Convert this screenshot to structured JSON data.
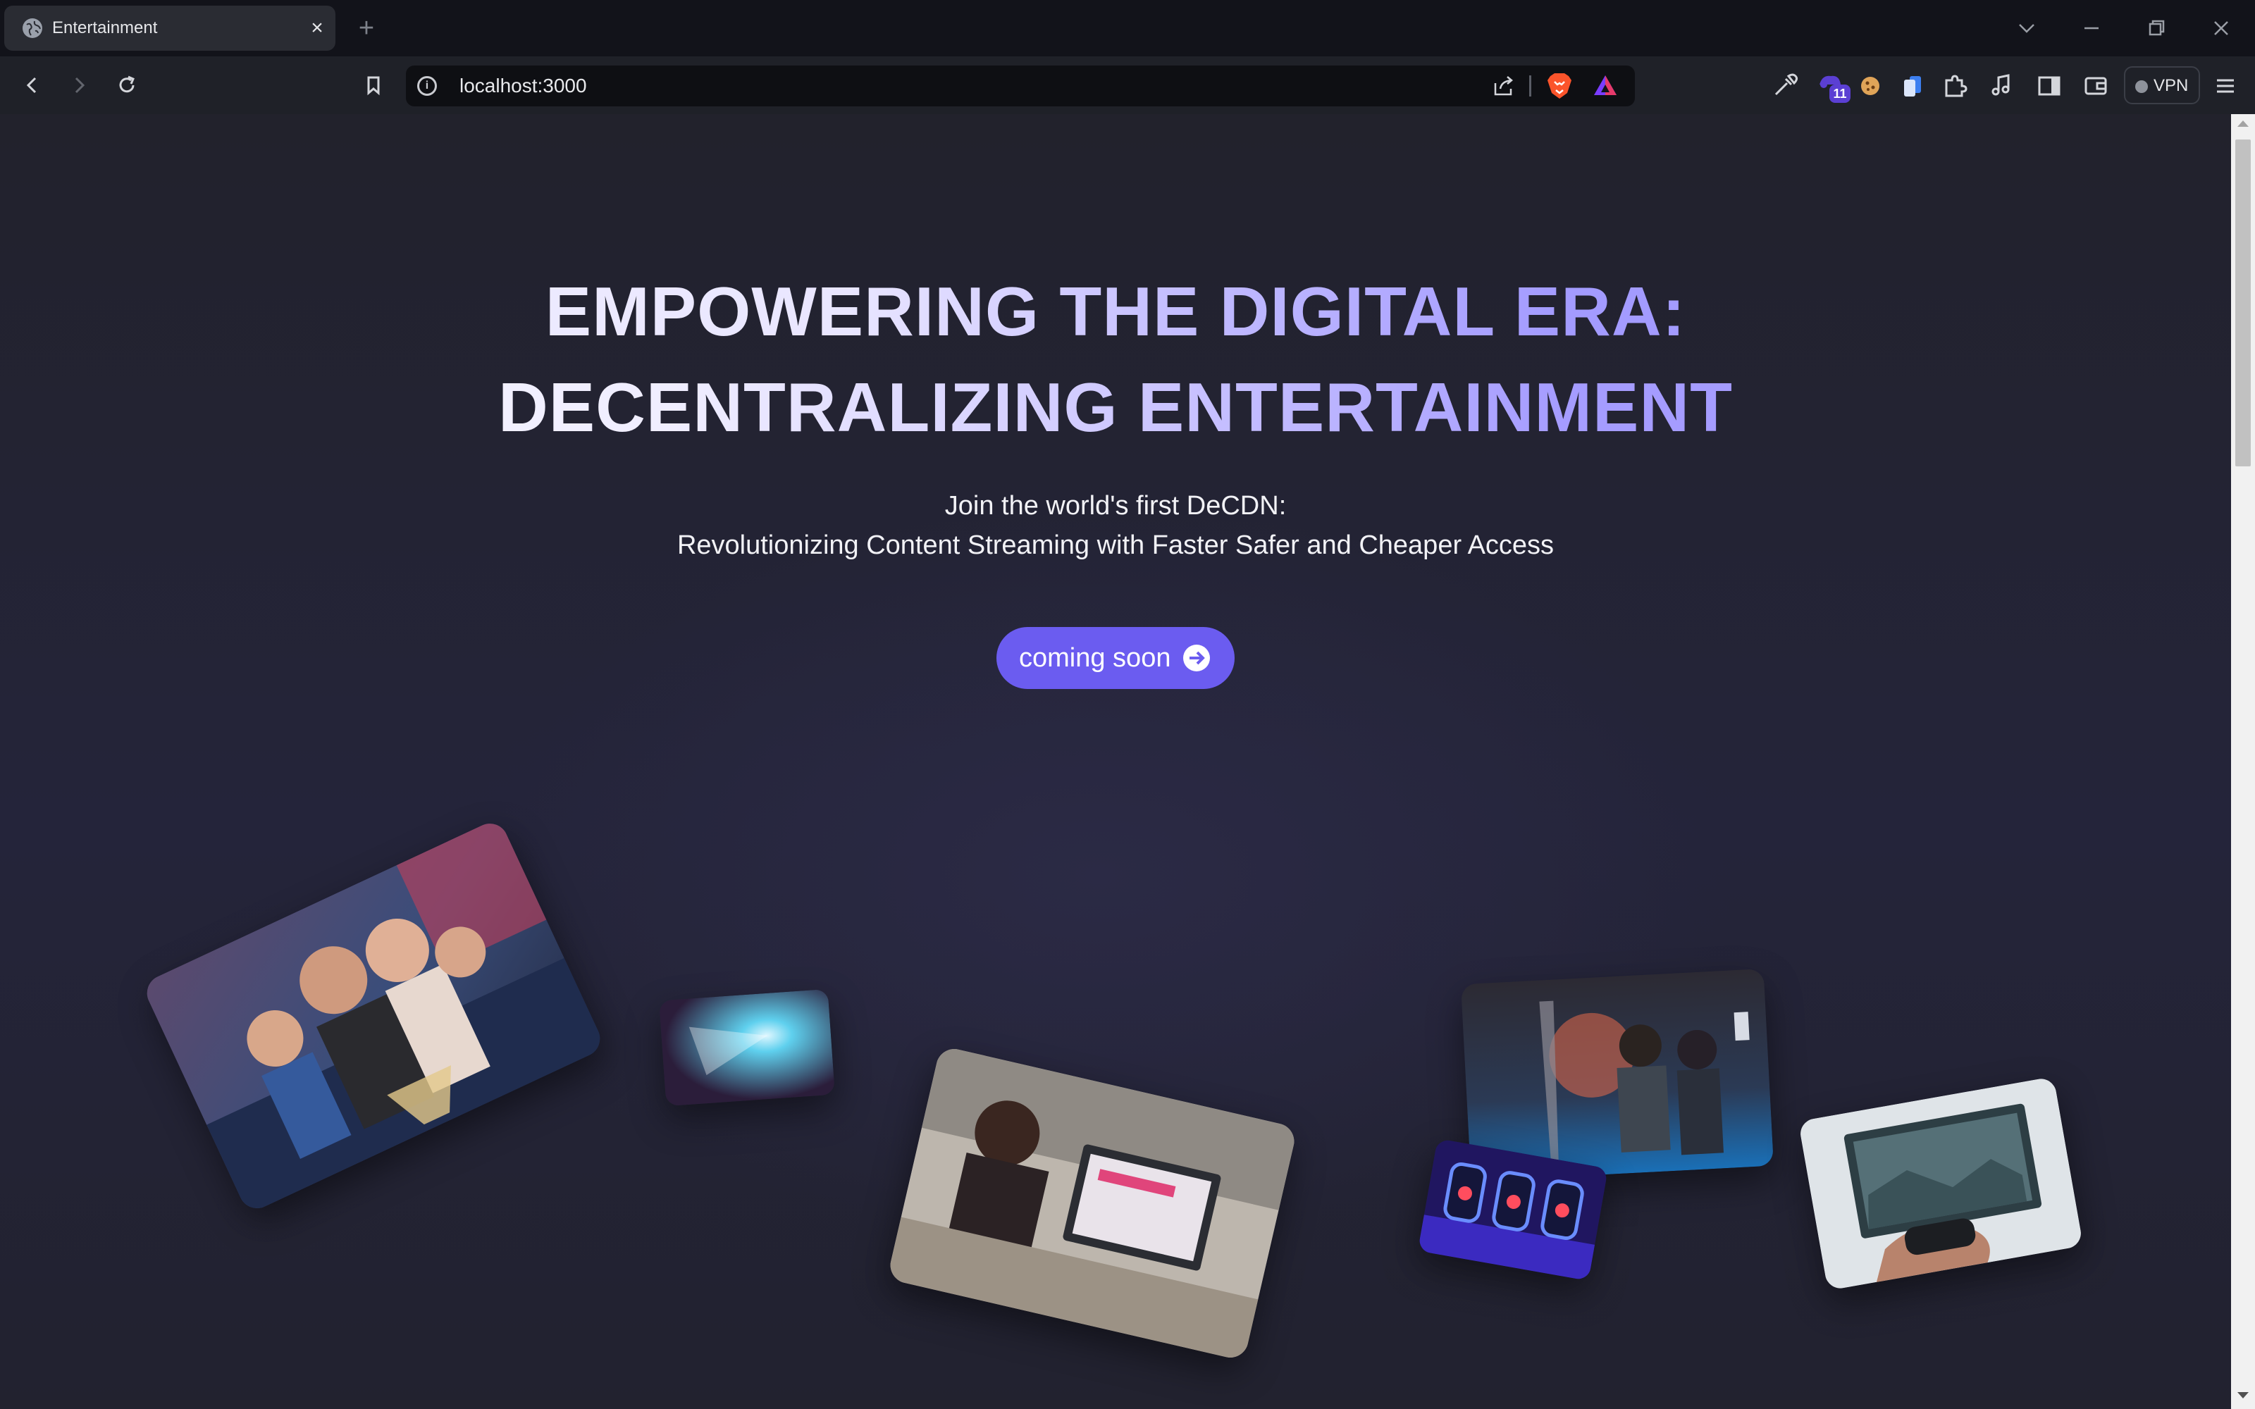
{
  "browser": {
    "tab": {
      "title": "Entertainment"
    },
    "url": "localhost:3000",
    "extension_badge": "11",
    "vpn_label": "VPN"
  },
  "hero": {
    "headline_line1": "EMPOWERING THE DIGITAL ERA:",
    "headline_line2": "DECENTRALIZING ENTERTAINMENT",
    "sub_line1": "Join the world's first DeCDN:",
    "sub_line2": "Revolutionizing Content Streaming with Faster Safer and Cheaper Access",
    "cta_label": "coming soon"
  },
  "colors": {
    "accent": "#6b5cf0",
    "headline_light": "#f3f1ff",
    "headline_purple": "#a39bff",
    "page_bg": "#22222c"
  },
  "icons": [
    "globe-icon",
    "close-icon",
    "plus-icon",
    "chevron-down-icon",
    "minimize-icon",
    "restore-icon",
    "window-close-icon",
    "back-icon",
    "forward-icon",
    "reload-icon",
    "bookmark-icon",
    "info-icon",
    "share-icon",
    "brave-shield-icon",
    "brave-rewards-icon",
    "eyedropper-icon",
    "extension-icon",
    "cookie-icon",
    "copy-icon",
    "puzzle-icon",
    "music-icon",
    "sidebar-icon",
    "wallet-icon",
    "menu-icon",
    "arrow-right-circle-icon"
  ],
  "photos": [
    "family-watching-movie-photo",
    "stage-spotlight-photo",
    "woman-at-computer-photo",
    "concert-band-photo",
    "neon-arcade-photo",
    "gaming-controller-photo"
  ]
}
